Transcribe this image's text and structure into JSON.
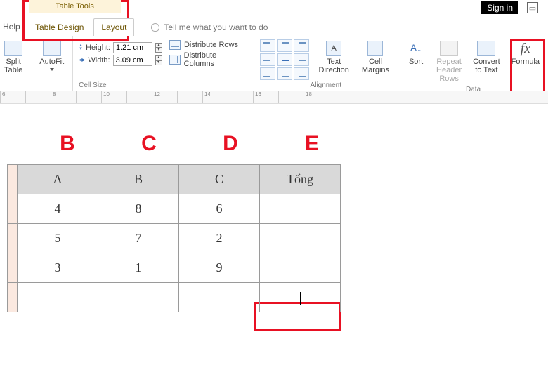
{
  "titlebar": {
    "signin": "Sign in"
  },
  "context_tab": {
    "title": "Table Tools"
  },
  "tabs": {
    "help": "Help",
    "design": "Table Design",
    "layout": "Layout",
    "tellme": "Tell me what you want to do"
  },
  "ribbon": {
    "split_table": "Split\nTable",
    "autofit": "AutoFit",
    "cellsize": {
      "height_label": "Height:",
      "height_value": "1.21 cm",
      "width_label": "Width:",
      "width_value": "3.09 cm",
      "dist_rows": "Distribute Rows",
      "dist_cols": "Distribute Columns",
      "group": "Cell Size"
    },
    "alignment": {
      "text_direction": "Text\nDirection",
      "cell_margins": "Cell\nMargins",
      "group": "Alignment"
    },
    "data": {
      "sort": "Sort",
      "repeat": "Repeat\nHeader Rows",
      "convert": "Convert\nto Text",
      "formula": "Formula",
      "group": "Data"
    }
  },
  "ruler_numbers": [
    "6",
    "",
    "8",
    "",
    "10",
    "",
    "12",
    "",
    "14",
    "",
    "16",
    "",
    "18"
  ],
  "letters": [
    "B",
    "C",
    "D",
    "E"
  ],
  "chart_data": {
    "type": "table",
    "headers": [
      "A",
      "B",
      "C",
      "Tổng"
    ],
    "rows": [
      [
        "4",
        "8",
        "6",
        ""
      ],
      [
        "5",
        "7",
        "2",
        ""
      ],
      [
        "3",
        "1",
        "9",
        ""
      ],
      [
        "",
        "",
        "",
        ""
      ]
    ]
  }
}
